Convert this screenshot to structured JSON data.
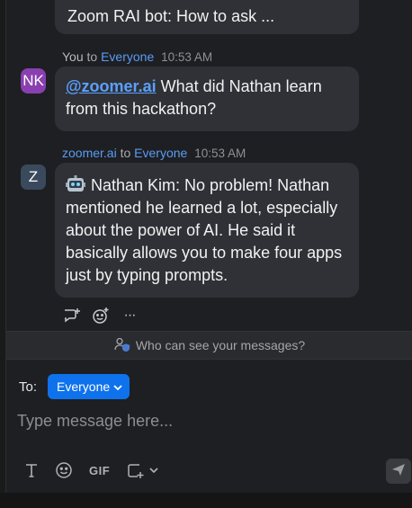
{
  "top_bubble": {
    "text": "Zoom RAI bot: How to ask ..."
  },
  "msg1": {
    "sender": "You",
    "to_word": "to",
    "recipient": "Everyone",
    "time": "10:53 AM",
    "avatar": "NK",
    "mention": "@zoomer.ai",
    "text": " What did Nathan learn from this hackathon?"
  },
  "msg2": {
    "sender": "zoomer.ai",
    "to_word": "to",
    "recipient": "Everyone",
    "time": "10:53 AM",
    "avatar": "Z",
    "text": "Nathan Kim: No problem! Nathan mentioned he learned a lot, especially about the power of AI. He said it basically allows you to make four apps just by typing prompts."
  },
  "privacy": {
    "label": "Who can see your messages?"
  },
  "compose": {
    "to_label": "To:",
    "recipient": "Everyone",
    "placeholder": "Type message here..."
  },
  "toolbar": {
    "gif_label": "GIF"
  },
  "reactions": {
    "more": "···"
  },
  "colors": {
    "avatar_nk": "#8a3fb0",
    "avatar_z": "#3a4a5c",
    "accent": "#0e72ed",
    "link": "#5a9bf6"
  }
}
